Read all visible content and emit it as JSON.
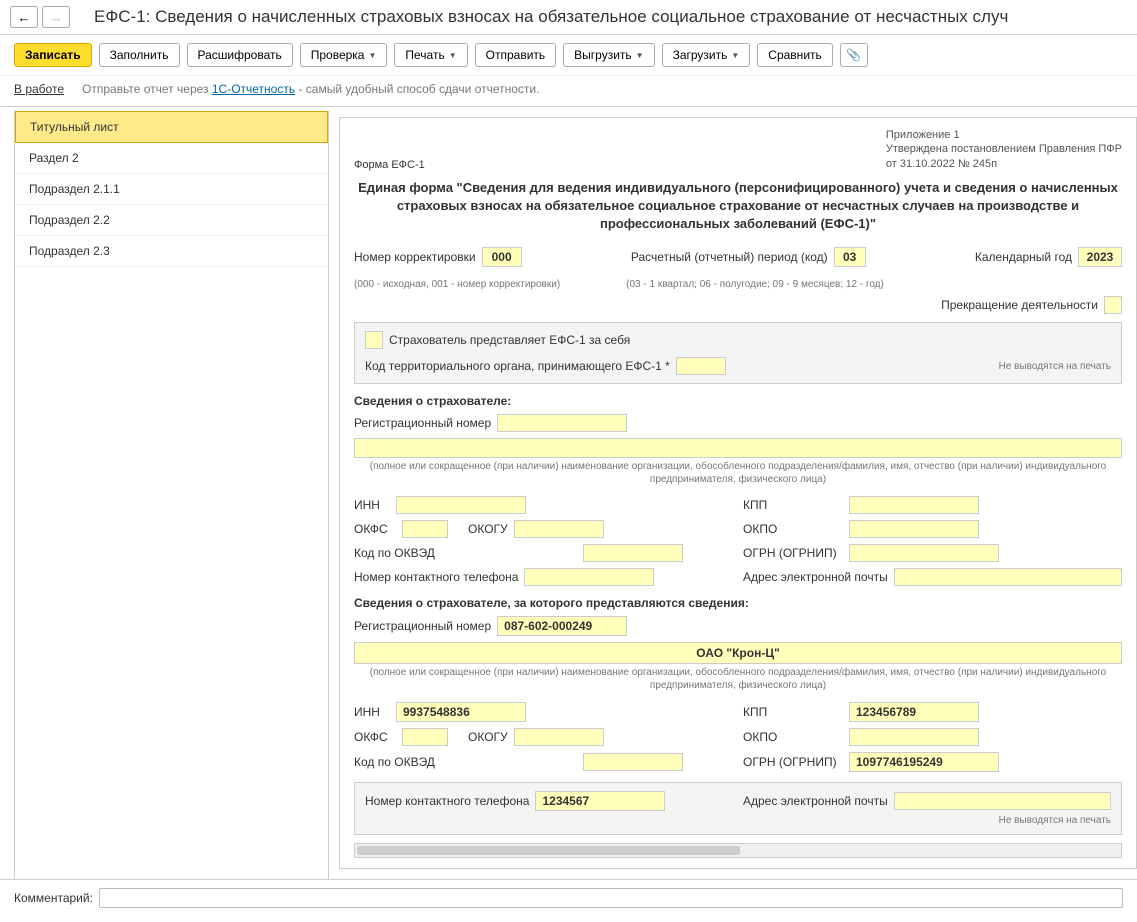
{
  "window_title": "ЕФС-1: Сведения о начисленных страховых взносах на обязательное социальное страхование от несчастных случ",
  "toolbar": {
    "save": "Записать",
    "fill": "Заполнить",
    "decrypt": "Расшифровать",
    "check": "Проверка",
    "print": "Печать",
    "send": "Отправить",
    "export": "Выгрузить",
    "import": "Загрузить",
    "compare": "Сравнить"
  },
  "status_label": "В работе",
  "hint_prefix": "Отправьте отчет через ",
  "hint_link": "1С-Отчетность",
  "hint_suffix": " - самый удобный способ сдачи отчетности.",
  "sidebar": {
    "items": [
      "Титульный лист",
      "Раздел 2",
      "Подраздел 2.1.1",
      "Подраздел 2.2",
      "Подраздел 2.3"
    ]
  },
  "form": {
    "form_code": "Форма ЕФС-1",
    "approval_line1": "Приложение 1",
    "approval_line2": "Утверждена постановлением Правления ПФР",
    "approval_line3": "от 31.10.2022 № 245п",
    "main_title": "Единая форма \"Сведения для ведения индивидуального (персонифицированного) учета и сведения о начисленных страховых взносах на обязательное социальное страхование от несчастных случаев на производстве и профессиональных заболеваний (ЕФС-1)\"",
    "corr_num_label": "Номер корректировки",
    "corr_num": "000",
    "corr_hint": "(000 - исходная, 001 - номер корректировки)",
    "period_label": "Расчетный (отчетный) период (код)",
    "period": "03",
    "period_hint": "(03 - 1 квартал; 06 - полугодие; 09 - 9 месяцев; 12 - год)",
    "year_label": "Календарный год",
    "year": "2023",
    "cease_label": "Прекращение деятельности",
    "self_submit_label": "Страхователь представляет ЕФС-1 за себя",
    "territory_label": "Код территориального органа, принимающего ЕФС-1 *",
    "not_printed": "Не выводятся на печать",
    "section1_title": "Сведения о страхователе:",
    "reg_num_label": "Регистрационный номер",
    "name_hint": "(полное или сокращенное (при наличии) наименование организации, обособленного подразделения/фамилия, имя, отчество (при наличии) индивидуального предпринимателя, физического лица)",
    "inn_label": "ИНН",
    "kpp_label": "КПП",
    "okfs_label": "ОКФС",
    "okogu_label": "ОКОГУ",
    "okpo_label": "ОКПО",
    "okved_label": "Код по ОКВЭД",
    "ogrn_label": "ОГРН (ОГРНИП)",
    "phone_label": "Номер контактного телефона",
    "email_label": "Адрес электронной почты",
    "section2_title": "Сведения о страхователе, за которого представляются сведения:",
    "rep": {
      "reg_num": "087-602-000249",
      "org_name": "ОАО \"Крон-Ц\"",
      "inn": "9937548836",
      "kpp": "123456789",
      "ogrn": "1097746195249",
      "phone": "1234567"
    }
  },
  "comment_label": "Комментарий:"
}
